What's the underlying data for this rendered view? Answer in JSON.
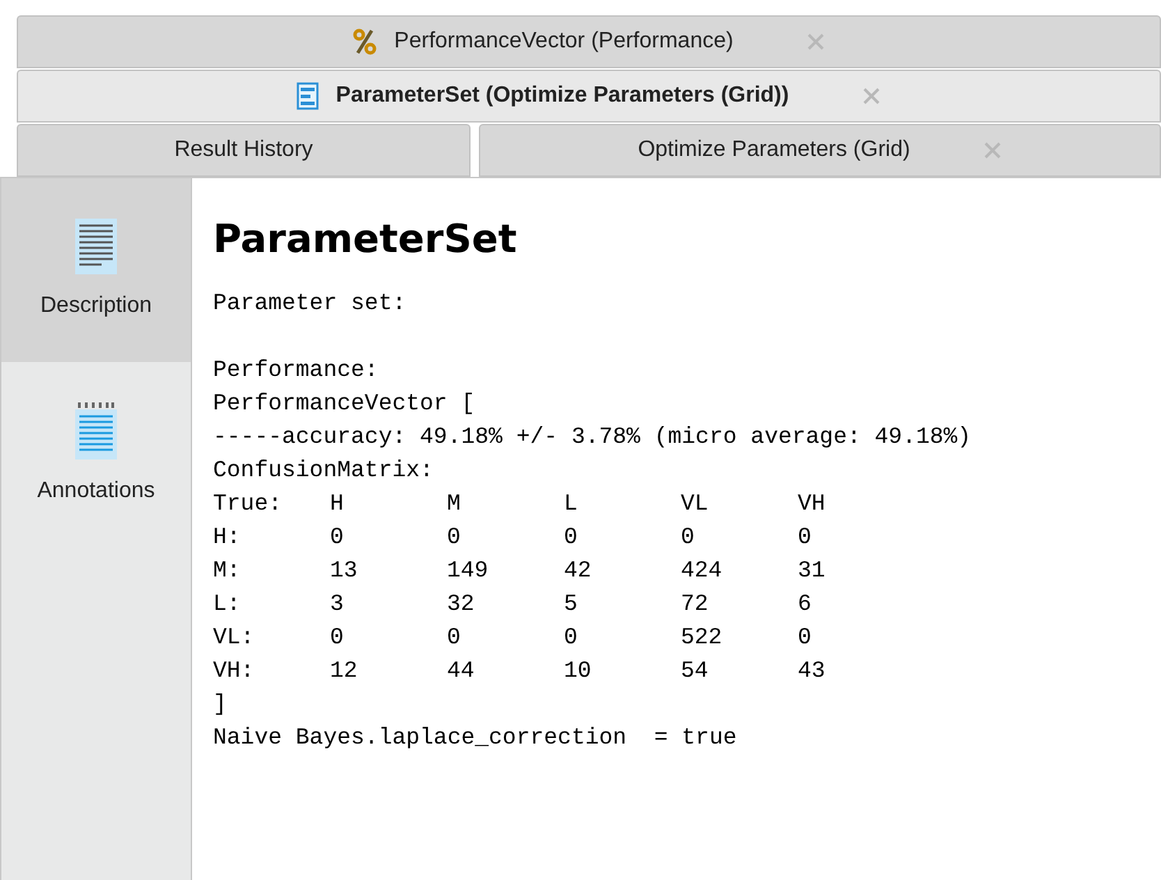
{
  "tab_rows": [
    [
      {
        "label": "PerformanceVector (Performance)",
        "kind": "percent",
        "selected": false,
        "closable": true
      }
    ],
    [
      {
        "label": "ParameterSet (Optimize Parameters (Grid))",
        "kind": "document",
        "selected": true,
        "closable": true
      }
    ],
    [
      {
        "label": "Result History",
        "selected": false,
        "closable": false
      },
      {
        "label": "Optimize Parameters (Grid)",
        "selected": false,
        "closable": true
      }
    ]
  ],
  "sidebar": {
    "items": [
      {
        "label": "Description",
        "kind": "description",
        "selected": true
      },
      {
        "label": "Annotations",
        "kind": "annotations",
        "selected": false
      }
    ]
  },
  "content": {
    "title": "ParameterSet",
    "intro": "Parameter set:",
    "lines_before": [
      "Performance:",
      "PerformanceVector [",
      "-----accuracy: 49.18% +/- 3.78% (micro average: 49.18%)",
      "ConfusionMatrix:"
    ],
    "matrix": {
      "columns": [
        "True:",
        "H",
        "M",
        "L",
        "VL",
        "VH"
      ],
      "rows": [
        [
          "H:",
          "0",
          "0",
          "0",
          "0",
          "0"
        ],
        [
          "M:",
          "13",
          "149",
          "42",
          "424",
          "31"
        ],
        [
          "L:",
          "3",
          "32",
          "5",
          "72",
          "6"
        ],
        [
          "VL:",
          "0",
          "0",
          "0",
          "522",
          "0"
        ],
        [
          "VH:",
          "12",
          "44",
          "10",
          "54",
          "43"
        ]
      ]
    },
    "lines_after": [
      "]",
      "Naive Bayes.laplace_correction  = true"
    ]
  }
}
